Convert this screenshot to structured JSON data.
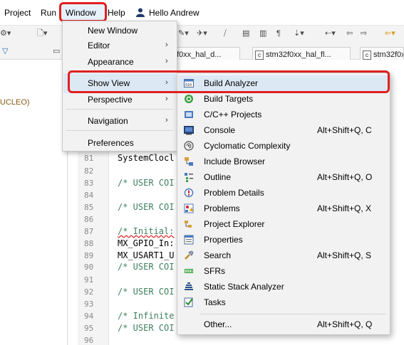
{
  "menubar": {
    "project": "Project",
    "run": "Run",
    "window": "Window",
    "help": "Help",
    "user": "Hello Andrew"
  },
  "tabs": [
    {
      "label": "f0xx_hal_d..."
    },
    {
      "label": "stm32f0xx_hal_fl..."
    },
    {
      "label": "stm32f0x"
    }
  ],
  "left_panel": {
    "text": "UCLEO)"
  },
  "window_menu": {
    "items": [
      {
        "label": "New Window",
        "submenu": false
      },
      {
        "label": "Editor",
        "submenu": true
      },
      {
        "label": "Appearance",
        "submenu": true
      },
      {
        "label": "Show View",
        "submenu": true
      },
      {
        "label": "Perspective",
        "submenu": true
      },
      {
        "label": "Navigation",
        "submenu": true
      },
      {
        "label": "Preferences",
        "submenu": false
      }
    ]
  },
  "show_view_menu": {
    "items": [
      {
        "label": "Build Analyzer",
        "shortcut": "",
        "icon": "build-analyzer-icon"
      },
      {
        "label": "Build Targets",
        "shortcut": "",
        "icon": "build-targets-icon"
      },
      {
        "label": "C/C++ Projects",
        "shortcut": "",
        "icon": "cpp-projects-icon"
      },
      {
        "label": "Console",
        "shortcut": "Alt+Shift+Q, C",
        "icon": "console-icon"
      },
      {
        "label": "Cyclomatic Complexity",
        "shortcut": "",
        "icon": "cyclomatic-complexity-icon"
      },
      {
        "label": "Include Browser",
        "shortcut": "",
        "icon": "include-browser-icon"
      },
      {
        "label": "Outline",
        "shortcut": "Alt+Shift+Q, O",
        "icon": "outline-icon"
      },
      {
        "label": "Problem Details",
        "shortcut": "",
        "icon": "problem-details-icon"
      },
      {
        "label": "Problems",
        "shortcut": "Alt+Shift+Q, X",
        "icon": "problems-icon"
      },
      {
        "label": "Project Explorer",
        "shortcut": "",
        "icon": "project-explorer-icon"
      },
      {
        "label": "Properties",
        "shortcut": "",
        "icon": "properties-icon"
      },
      {
        "label": "Search",
        "shortcut": "Alt+Shift+Q, S",
        "icon": "search-icon"
      },
      {
        "label": "SFRs",
        "shortcut": "",
        "icon": "sfrs-icon"
      },
      {
        "label": "Static Stack Analyzer",
        "shortcut": "",
        "icon": "static-stack-analyzer-icon"
      },
      {
        "label": "Tasks",
        "shortcut": "",
        "icon": "tasks-icon"
      },
      {
        "label": "Other...",
        "shortcut": "Alt+Shift+Q, Q",
        "icon": ""
      }
    ]
  },
  "editor": {
    "lines": [
      {
        "num": "81",
        "code": "SystemClocl",
        "kind": "fn"
      },
      {
        "num": "82",
        "code": "",
        "kind": "fn"
      },
      {
        "num": "83",
        "code": "/* USER COI",
        "kind": "cm"
      },
      {
        "num": "84",
        "code": "",
        "kind": "fn"
      },
      {
        "num": "85",
        "code": "/* USER COI",
        "kind": "cm"
      },
      {
        "num": "86",
        "code": "",
        "kind": "fn"
      },
      {
        "num": "87",
        "code": "/* Initial:",
        "kind": "cm"
      },
      {
        "num": "88",
        "code": "MX_GPIO_In:",
        "kind": "fn"
      },
      {
        "num": "89",
        "code": "MX_USART1_U",
        "kind": "fn"
      },
      {
        "num": "90",
        "code": "/* USER COI",
        "kind": "cm"
      },
      {
        "num": "91",
        "code": "",
        "kind": "fn"
      },
      {
        "num": "92",
        "code": "/* USER COI",
        "kind": "cm"
      },
      {
        "num": "93",
        "code": "",
        "kind": "fn"
      },
      {
        "num": "94",
        "code": "/* Infinite",
        "kind": "cm"
      },
      {
        "num": "95",
        "code": "/* USER COI",
        "kind": "cm"
      },
      {
        "num": "96",
        "code": "",
        "kind": "fn"
      }
    ]
  },
  "colors": {
    "highlight_border": "#e02020",
    "menu_hover": "#dde8f5",
    "comment": "#3f7f5f"
  }
}
